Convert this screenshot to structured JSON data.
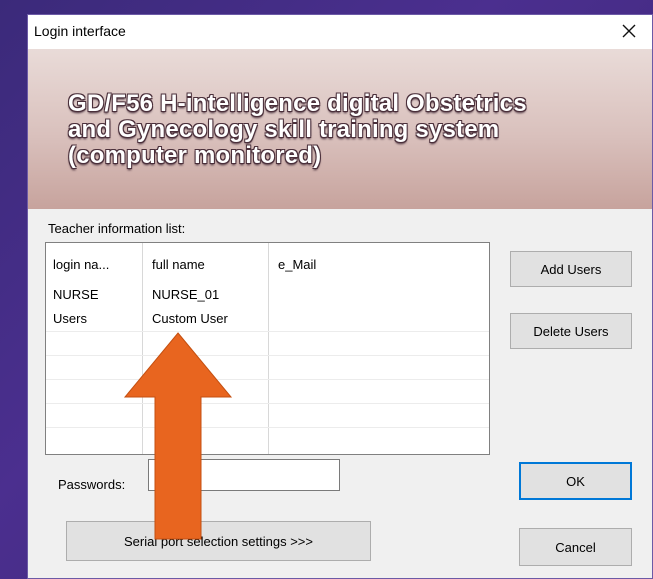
{
  "window": {
    "title": "Login interface"
  },
  "banner": {
    "line1": "GD/F56 H-intelligence digital Obstetrics",
    "line2": "and Gynecology skill training system",
    "line3": "(computer monitored)"
  },
  "teacher_list": {
    "label": "Teacher information list:",
    "columns": [
      "login na...",
      "full name",
      "e_Mail"
    ],
    "rows": [
      [
        "NURSE",
        "NURSE_01",
        ""
      ],
      [
        "Users",
        "Custom User",
        ""
      ]
    ]
  },
  "buttons": {
    "add_users": "Add Users",
    "delete_users": "Delete Users",
    "ok": "OK",
    "cancel": "Cancel",
    "serial_port": "Serial port selection settings   >>>"
  },
  "password": {
    "label": "Passwords:",
    "value": ""
  },
  "colors": {
    "arrow": "#e8651f",
    "focus": "#0078d7"
  },
  "icons": {
    "close": "close-icon",
    "annotation": "arrow-up-icon"
  }
}
